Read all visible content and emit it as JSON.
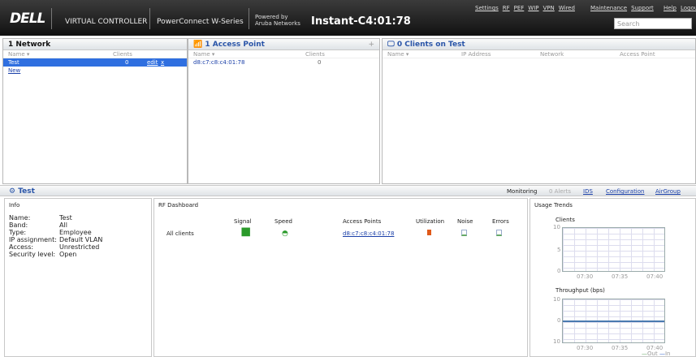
{
  "header": {
    "brand": "DELL",
    "product": "VIRTUAL CONTROLLER",
    "series": "PowerConnect W-Series",
    "powered_line1": "Powered by",
    "powered_line2": "Aruba Networks",
    "instance": "Instant-C4:01:78",
    "links": [
      "Settings",
      "RF",
      "PEF",
      "WIP",
      "VPN",
      "Wired"
    ],
    "links2": [
      "Maintenance",
      "Support"
    ],
    "links3": [
      "Help",
      "Logout"
    ],
    "search_placeholder": "Search"
  },
  "networks": {
    "title": "1 Network",
    "col_name": "Name",
    "col_clients": "Clients",
    "rows": [
      {
        "name": "Test",
        "clients": "0",
        "edit": "edit",
        "x": "x"
      }
    ],
    "new_link": "New"
  },
  "aps": {
    "title": "1 Access Point",
    "plus": "+",
    "col_name": "Name",
    "col_clients": "Clients",
    "rows": [
      {
        "name": "d8:c7:c8:c4:01:78",
        "clients": "0"
      }
    ]
  },
  "clients": {
    "title": "0 Clients on Test",
    "cols": [
      "Name",
      "IP Address",
      "Network",
      "Access Point"
    ]
  },
  "section": {
    "title": "Test",
    "tabs": [
      "Monitoring",
      "0 Alerts",
      "IDS",
      "Configuration",
      "AirGroup"
    ]
  },
  "info": {
    "title": "Info",
    "fields": [
      [
        "Name:",
        "Test"
      ],
      [
        "Band:",
        "All"
      ],
      [
        "Type:",
        "Employee"
      ],
      [
        "IP assignment:",
        "Default VLAN"
      ],
      [
        "Access:",
        "Unrestricted"
      ],
      [
        "Security level:",
        "Open"
      ]
    ]
  },
  "rf": {
    "title": "RF Dashboard",
    "cols": [
      "Signal",
      "Speed",
      "Access Points",
      "Utilization",
      "Noise",
      "Errors"
    ],
    "row_label": "All clients",
    "ap_link": "d8:c7:c8:c4:01:78"
  },
  "usage": {
    "title": "Usage Trends",
    "clients_label": "Clients",
    "clients_ticks": [
      "10",
      "5",
      "0"
    ],
    "times": [
      "07:30",
      "07:35",
      "07:40"
    ],
    "throughput_label": "Throughput  (bps)",
    "tp_ticks": [
      "10",
      "0",
      "10"
    ],
    "legend_out": "Out",
    "legend_in": "In"
  }
}
